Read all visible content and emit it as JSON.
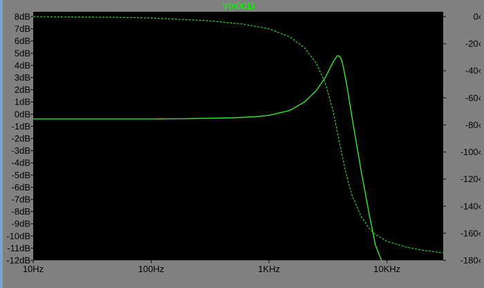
{
  "window": {
    "title": "V(n001)"
  },
  "colors": {
    "frame": "#808080",
    "plot_background": "#000000",
    "trace": "#33e833",
    "trace_title": "#00ff00",
    "axis_text": "#000000",
    "left_strip": "#7aa2c8"
  },
  "chart_data": {
    "type": "line",
    "title": "V(n001)",
    "x_scale": "log",
    "xlim": [
      10,
      30000
    ],
    "x_ticks": [
      {
        "value": 10,
        "label": "10Hz"
      },
      {
        "value": 100,
        "label": "100Hz"
      },
      {
        "value": 1000,
        "label": "1KHz"
      },
      {
        "value": 10000,
        "label": "10KHz"
      }
    ],
    "ylim_left": [
      -12,
      8
    ],
    "y_ticks_left": [
      {
        "value": 8,
        "label": "8dB"
      },
      {
        "value": 7,
        "label": "7dB"
      },
      {
        "value": 6,
        "label": "6dB"
      },
      {
        "value": 5,
        "label": "5dB"
      },
      {
        "value": 4,
        "label": "4dB"
      },
      {
        "value": 3,
        "label": "3dB"
      },
      {
        "value": 2,
        "label": "2dB"
      },
      {
        "value": 1,
        "label": "1dB"
      },
      {
        "value": 0,
        "label": "0dB"
      },
      {
        "value": -1,
        "label": "-1dB"
      },
      {
        "value": -2,
        "label": "-2dB"
      },
      {
        "value": -3,
        "label": "-3dB"
      },
      {
        "value": -4,
        "label": "-4dB"
      },
      {
        "value": -5,
        "label": "-5dB"
      },
      {
        "value": -6,
        "label": "-6dB"
      },
      {
        "value": -7,
        "label": "-7dB"
      },
      {
        "value": -8,
        "label": "-8dB"
      },
      {
        "value": -9,
        "label": "-9dB"
      },
      {
        "value": -10,
        "label": "-10dB"
      },
      {
        "value": -11,
        "label": "-11dB"
      },
      {
        "value": -12,
        "label": "-12dB"
      }
    ],
    "ylim_right": [
      -180,
      0
    ],
    "y_ticks_right": [
      {
        "value": 0,
        "label": "0‹"
      },
      {
        "value": -20,
        "label": "-20‹"
      },
      {
        "value": -40,
        "label": "-40‹"
      },
      {
        "value": -60,
        "label": "-60‹"
      },
      {
        "value": -80,
        "label": "-80‹"
      },
      {
        "value": -100,
        "label": "-100‹"
      },
      {
        "value": -120,
        "label": "-120‹"
      },
      {
        "value": -140,
        "label": "-140‹"
      },
      {
        "value": -160,
        "label": "-160‹"
      },
      {
        "value": -180,
        "label": "-180‹"
      }
    ],
    "series": [
      {
        "axis": "left",
        "style": "solid",
        "x": [
          10,
          50,
          100,
          200,
          500,
          800,
          1000,
          1500,
          2000,
          2500,
          3000,
          3300,
          3600,
          3800,
          4000,
          4200,
          4600,
          5000,
          6000,
          7000,
          8000,
          9000
        ],
        "y": [
          -0.4,
          -0.4,
          -0.4,
          -0.38,
          -0.3,
          -0.2,
          -0.1,
          0.3,
          1.0,
          1.9,
          3.0,
          3.8,
          4.5,
          4.8,
          4.75,
          4.2,
          2.2,
          0.0,
          -4.5,
          -8.0,
          -10.8,
          -12.0
        ]
      },
      {
        "axis": "right",
        "style": "dashed",
        "x": [
          10,
          50,
          100,
          300,
          600,
          1000,
          1500,
          2000,
          2500,
          3000,
          3500,
          4000,
          4500,
          5000,
          6000,
          7000,
          8000,
          10000,
          15000,
          20000,
          30000
        ],
        "y": [
          0,
          -0.5,
          -1,
          -3,
          -5.5,
          -9,
          -15,
          -23,
          -34,
          -49,
          -70,
          -95,
          -116,
          -131,
          -147,
          -156,
          -161,
          -166,
          -170.5,
          -172.5,
          -174.5
        ]
      }
    ]
  }
}
